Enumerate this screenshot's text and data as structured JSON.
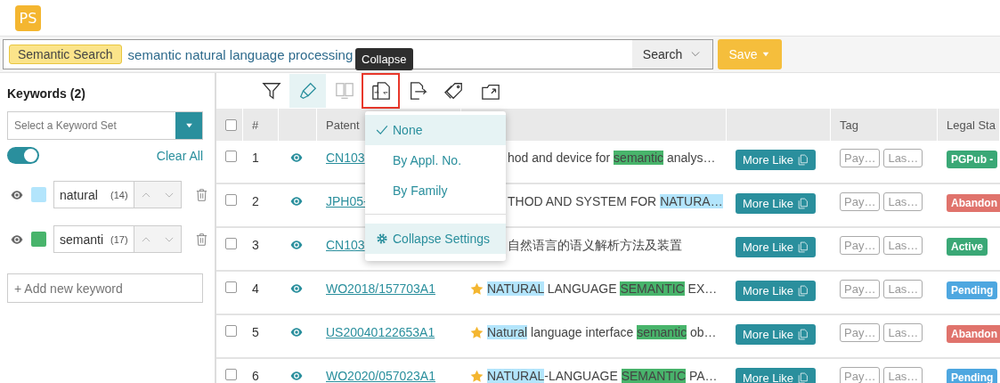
{
  "logo": "PS",
  "search": {
    "mode": "Semantic Search",
    "query": "semantic natural language processing",
    "button": "Search"
  },
  "save": "Save",
  "keywords": {
    "title": "Keywords (2)",
    "set_placeholder": "Select a Keyword Set",
    "highlight_on": true,
    "clear": "Clear All",
    "add_placeholder": "+ Add new keyword",
    "items": [
      {
        "word": "natural",
        "count": "(14)",
        "color": "#b3e5fc"
      },
      {
        "word": "semanti",
        "count": "(17)",
        "color": "#48b46b"
      }
    ]
  },
  "toolbar": [
    {
      "kind": "filter",
      "active": false,
      "disabled": false,
      "open": false
    },
    {
      "kind": "highlight",
      "active": true,
      "disabled": false,
      "open": false
    },
    {
      "kind": "compare",
      "active": false,
      "disabled": true,
      "open": false
    },
    {
      "kind": "collapse",
      "active": false,
      "disabled": false,
      "open": true,
      "tooltip": "Collapse"
    },
    {
      "kind": "export",
      "active": false,
      "disabled": false,
      "open": false
    },
    {
      "kind": "tags",
      "active": false,
      "disabled": false,
      "open": false
    },
    {
      "kind": "save",
      "active": false,
      "disabled": false,
      "open": false
    }
  ],
  "collapse_menu": {
    "items": [
      {
        "label": "None",
        "selected": true
      },
      {
        "label": "By Appl. No.",
        "selected": false
      },
      {
        "label": "By Family",
        "selected": false
      }
    ],
    "settings": "Collapse Settings"
  },
  "table": {
    "select_all_checked": false,
    "columns": {
      "number": "#",
      "patent": "Patent",
      "tag": "Tag",
      "legal_status": "Legal Sta"
    },
    "rows": [
      {
        "checked": false,
        "number": "1",
        "patent": "CN103",
        "starred": false,
        "title": [
          {
            "text": "hod and device for "
          },
          {
            "text": "semantic",
            "color": "#48b46b"
          },
          {
            "text": " analys…"
          }
        ],
        "more": "More Like",
        "tags": [
          "Pay…",
          "Las…"
        ],
        "status": "PGPub -",
        "color": "#3aa876"
      },
      {
        "checked": false,
        "number": "2",
        "patent": "JPH05-",
        "starred": false,
        "title": [
          {
            "text": "THOD AND SYSTEM FOR "
          },
          {
            "text": "NATURA…",
            "color": "#b3e5fc"
          }
        ],
        "more": "More Like",
        "tags": [
          "Pay…",
          "Las…"
        ],
        "status": "Abandon",
        "color": "#e0736c"
      },
      {
        "checked": false,
        "number": "3",
        "patent": "CN103",
        "starred": false,
        "title": [
          {
            "text": "自然语言的语义解析方法及装置"
          }
        ],
        "more": "More Like",
        "tags": [
          "Pay…",
          "Las…"
        ],
        "status": "Active",
        "color": "#3aa876"
      },
      {
        "checked": false,
        "number": "4",
        "patent": "WO2018/157703A1",
        "starred": true,
        "title": [
          {
            "text": "NATURAL",
            "color": "#b3e5fc"
          },
          {
            "text": " LANGUAGE "
          },
          {
            "text": "SEMANTIC",
            "color": "#48b46b"
          },
          {
            "text": " EX…"
          }
        ],
        "more": "More Like",
        "tags": [
          "Pay…",
          "Las…"
        ],
        "status": "Pending",
        "color": "#4ea7e0"
      },
      {
        "checked": false,
        "number": "5",
        "patent": "US20040122653A1",
        "starred": true,
        "title": [
          {
            "text": "Natural",
            "color": "#b3e5fc"
          },
          {
            "text": " language interface "
          },
          {
            "text": "semantic",
            "color": "#48b46b"
          },
          {
            "text": " ob…"
          }
        ],
        "more": "More Like",
        "tags": [
          "Pay…",
          "Las…"
        ],
        "status": "Abandon",
        "color": "#e0736c"
      },
      {
        "checked": false,
        "number": "6",
        "patent": "WO2020/057023A1",
        "starred": true,
        "title": [
          {
            "text": "NATURAL",
            "color": "#b3e5fc"
          },
          {
            "text": "-LANGUAGE "
          },
          {
            "text": "SEMANTIC",
            "color": "#48b46b"
          },
          {
            "text": " PA…"
          }
        ],
        "more": "More Like",
        "tags": [
          "Pay…",
          "Las…"
        ],
        "status": "Pending",
        "color": "#4ea7e0"
      }
    ]
  }
}
